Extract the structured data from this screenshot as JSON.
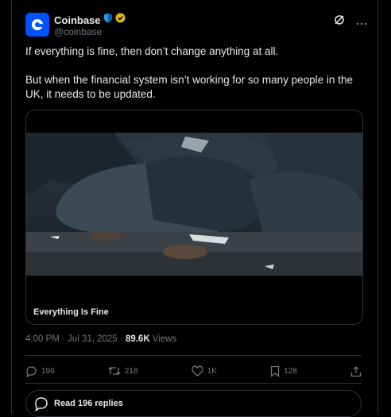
{
  "account": {
    "name": "Coinbase",
    "handle": "@coinbase"
  },
  "tweet": {
    "paragraphs": [
      "If everything is fine, then don’t change anything at all.",
      "But when the financial system isn’t working for so many people in the UK, it needs to be updated."
    ]
  },
  "media": {
    "title": "Everything Is Fine"
  },
  "meta": {
    "timestamp": "4:00 PM · Jul 31, 2025 ·",
    "views_count": "89.6K",
    "views_label": "Views"
  },
  "actions": {
    "replies": "196",
    "reposts": "218",
    "likes": "1K",
    "bookmarks": "128"
  },
  "replies_button": {
    "label": "Read 196 replies"
  },
  "colors": {
    "background": "#000000",
    "brand": "#0052ff",
    "text": "#e7e9ea",
    "muted": "#71767b",
    "border": "#2f3336"
  }
}
